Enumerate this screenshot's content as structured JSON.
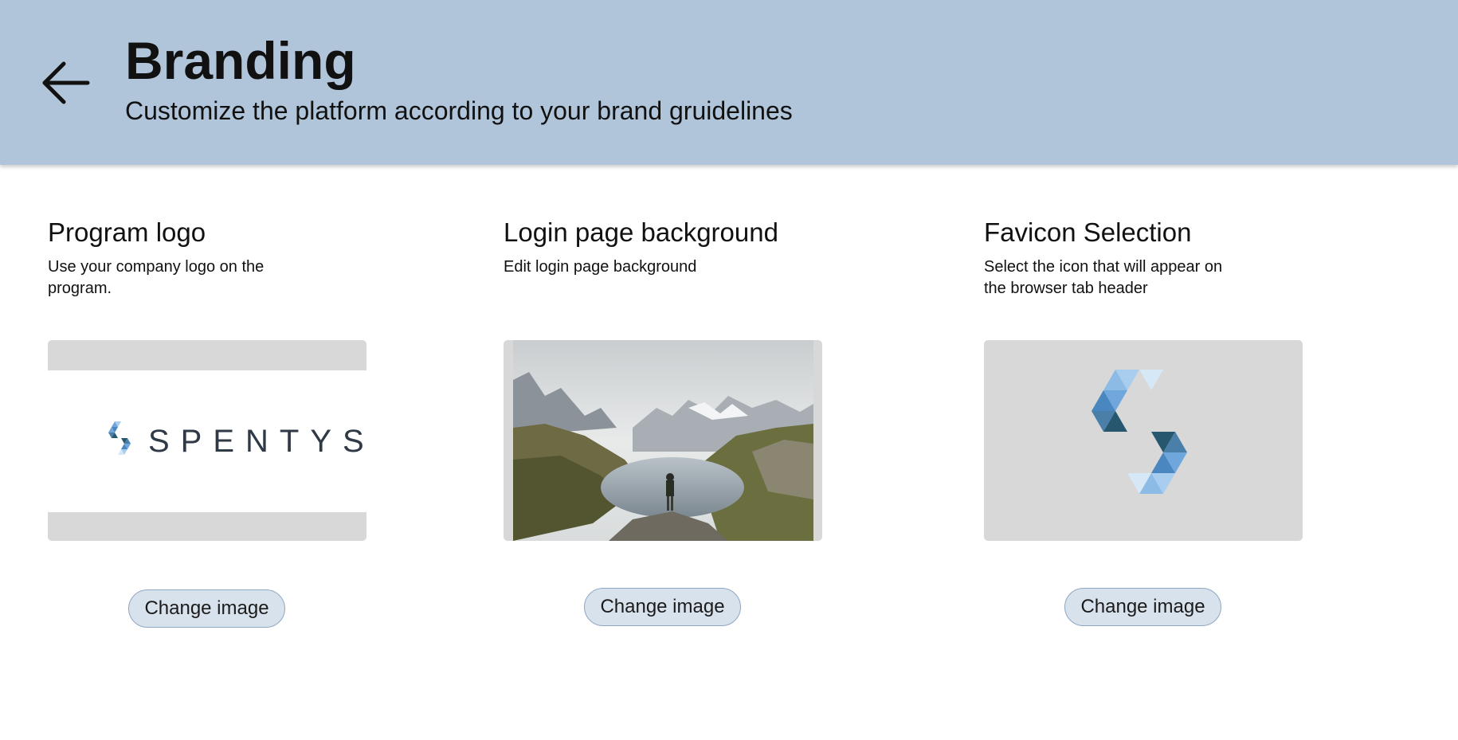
{
  "header": {
    "back_icon": "arrow-left-icon",
    "title": "Branding",
    "subtitle": "Customize the platform according to your brand gruidelines",
    "background_color": "#b1c5da"
  },
  "cards": [
    {
      "title": "Program logo",
      "description": "Use your company logo on the program.",
      "preview": {
        "type": "logo",
        "icon": "spentys-logo-icon",
        "wordmark": "SPENTYS"
      },
      "button_label": "Change image"
    },
    {
      "title": "Login page background",
      "description": "Edit login page background",
      "preview": {
        "type": "photo",
        "subject": "mountain-lake-photo"
      },
      "button_label": "Change image"
    },
    {
      "title": "Favicon Selection",
      "description": "Select the icon that will appear on the browser tab header",
      "preview": {
        "type": "icon",
        "icon": "spentys-favicon-icon"
      },
      "button_label": "Change image"
    }
  ],
  "colors": {
    "button_background": "#d8e2ec",
    "button_border": "#8fa7c2",
    "preview_background": "#d8d8d8",
    "logo_blue_light": "#a9cdee",
    "logo_blue_mid": "#6fa6dc",
    "logo_blue_dark": "#27566f"
  }
}
